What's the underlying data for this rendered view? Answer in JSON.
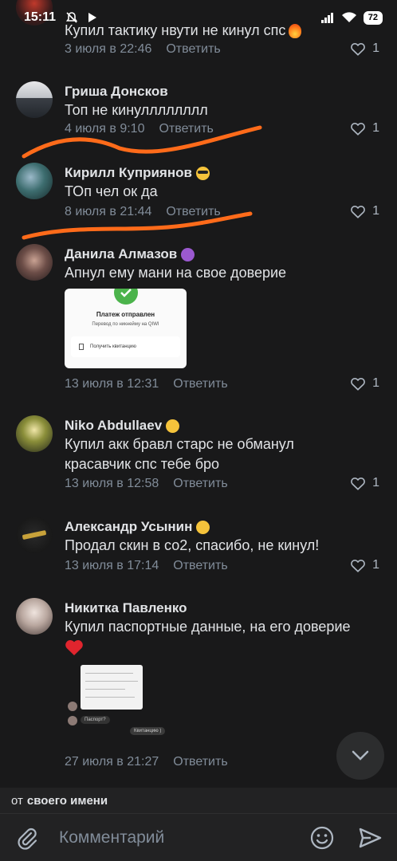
{
  "status_bar": {
    "time": "15:11",
    "battery": "72"
  },
  "comments": [
    {
      "author": "",
      "text": "Купил тактику нвути не кинул спс",
      "date": "3 июля в 22:46",
      "reply": "Ответить",
      "likes": "1"
    },
    {
      "author": "Гриша Донсков",
      "text": "Топ не кинулллллллл",
      "date": "4 июля в 9:10",
      "reply": "Ответить",
      "likes": "1"
    },
    {
      "author": "Кирилл Куприянов",
      "text": "ТОп чел ок да",
      "date": "8 июля в 21:44",
      "reply": "Ответить",
      "likes": "1"
    },
    {
      "author": "Данила Алмазов",
      "text": "Апнул ему мани на свое доверие",
      "date": "13 июля в 12:31",
      "reply": "Ответить",
      "likes": "1",
      "attachment": {
        "title": "Платеж отправлен",
        "subtitle": "Перевод по никнейму на QIWI",
        "action": "Получить квитанцию"
      }
    },
    {
      "author": "Niko Abdullaev",
      "text_line1": "Купил акк бравл старс не обманул",
      "text_line2": "красавчик спс тебе бро",
      "date": "13 июля в 12:58",
      "reply": "Ответить",
      "likes": "1"
    },
    {
      "author": "Александр Усынин",
      "text": "Продал скин в со2, спасибо, не кинул!",
      "date": "13 июля в 17:14",
      "reply": "Ответить",
      "likes": "1"
    },
    {
      "author": "Никитка Павленко",
      "text": "Купил паспортные данные, на его доверие",
      "date": "27 июля в 21:27",
      "reply": "Ответить",
      "attachment": {
        "bubble1": "Паспорт?",
        "bubble2": "Квитанцию )"
      }
    }
  ],
  "from_bar": {
    "prefix": "от",
    "name": "своего имени"
  },
  "input": {
    "placeholder": "Комментарий"
  },
  "colors": {
    "background": "#19191a",
    "scribble": "#ff6b1a",
    "accent_green": "#4bb34b"
  },
  "icons": [
    "mute-icon",
    "play-icon",
    "signal-icon",
    "wifi-icon",
    "heart-icon",
    "chevron-down-icon",
    "paperclip-icon",
    "smile-icon",
    "send-icon"
  ]
}
